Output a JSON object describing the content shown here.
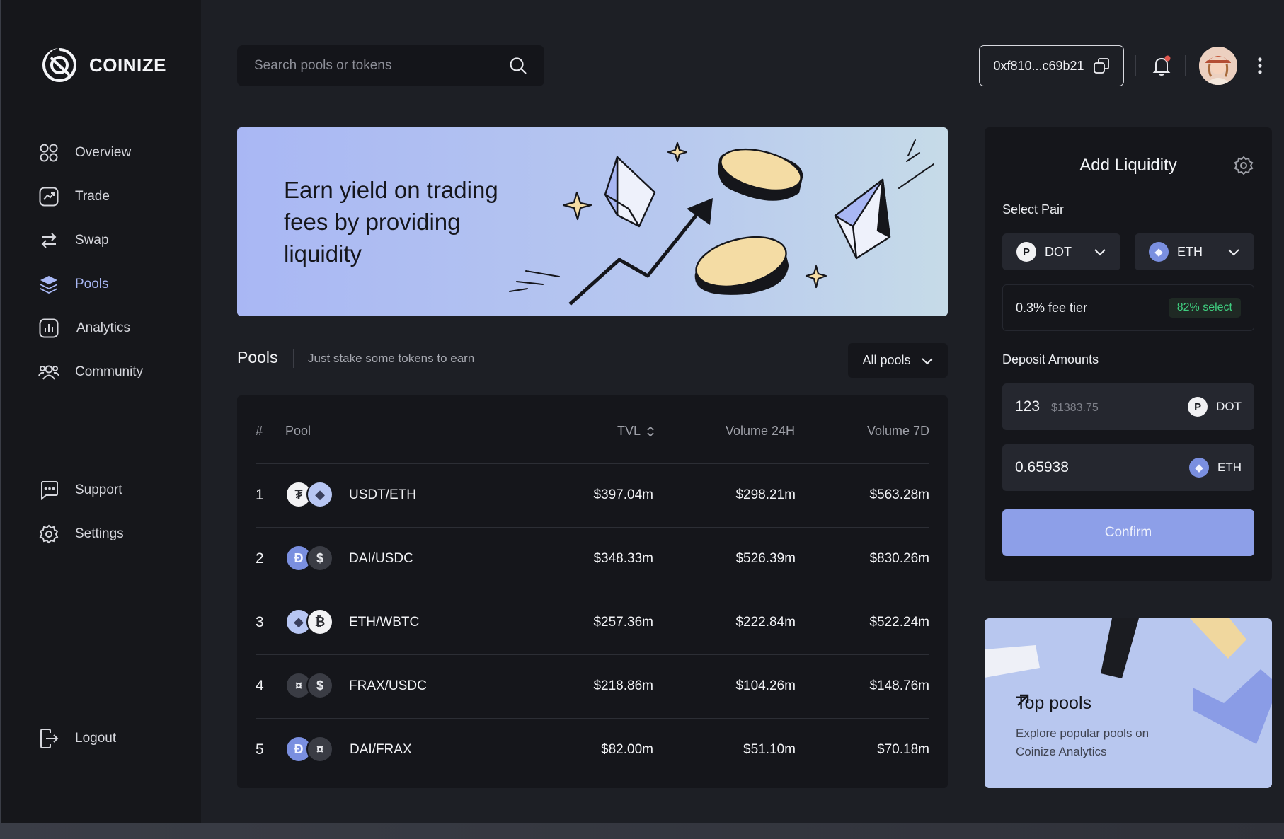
{
  "brand": {
    "name": "COINIZE"
  },
  "sidebar": {
    "items": [
      {
        "label": "Overview",
        "icon": "grid-icon"
      },
      {
        "label": "Trade",
        "icon": "trend-icon"
      },
      {
        "label": "Swap",
        "icon": "swap-icon"
      },
      {
        "label": "Pools",
        "icon": "layers-icon",
        "active": true
      },
      {
        "label": "Analytics",
        "icon": "bar-chart-icon"
      },
      {
        "label": "Community",
        "icon": "users-icon"
      }
    ],
    "secondary": [
      {
        "label": "Support",
        "icon": "chat-icon"
      },
      {
        "label": "Settings",
        "icon": "gear-icon"
      }
    ],
    "logout": "Logout"
  },
  "header": {
    "search_placeholder": "Search pools or tokens",
    "wallet": "0xf810...c69b21",
    "notification_dot_color": "#e2584f"
  },
  "hero": {
    "text": "Earn yield on trading fees by providing liquidity"
  },
  "pools": {
    "title": "Pools",
    "subtitle": "Just stake some tokens to earn",
    "filter": "All pools",
    "columns": {
      "index": "#",
      "pool": "Pool",
      "tvl": "TVL",
      "vol24": "Volume 24H",
      "vol7": "Volume 7D"
    },
    "rows": [
      {
        "n": "1",
        "pair": "USDT/ETH",
        "tvl": "$397.04m",
        "vol24": "$298.21m",
        "vol7": "$563.28m",
        "tokens": [
          "tether",
          "eth"
        ]
      },
      {
        "n": "2",
        "pair": "DAI/USDC",
        "tvl": "$348.33m",
        "vol24": "$526.39m",
        "vol7": "$830.26m",
        "tokens": [
          "dai",
          "usdc"
        ]
      },
      {
        "n": "3",
        "pair": "ETH/WBTC",
        "tvl": "$257.36m",
        "vol24": "$222.84m",
        "vol7": "$522.24m",
        "tokens": [
          "eth",
          "btc"
        ]
      },
      {
        "n": "4",
        "pair": "FRAX/USDC",
        "tvl": "$218.86m",
        "vol24": "$104.26m",
        "vol7": "$148.76m",
        "tokens": [
          "frax",
          "usdc"
        ]
      },
      {
        "n": "5",
        "pair": "DAI/FRAX",
        "tvl": "$82.00m",
        "vol24": "$51.10m",
        "vol7": "$70.18m",
        "tokens": [
          "dai",
          "frax"
        ]
      }
    ]
  },
  "liquidity": {
    "title": "Add Liquidity",
    "select_pair_label": "Select Pair",
    "token_a": "DOT",
    "token_b": "ETH",
    "fee_tier": "0.3% fee tier",
    "fee_badge": "82% select",
    "deposit_label": "Deposit Amounts",
    "deposit_a": {
      "value": "123",
      "usd": "$1383.75",
      "token": "DOT"
    },
    "deposit_b": {
      "value": "0.65938",
      "token": "ETH"
    },
    "confirm": "Confirm"
  },
  "top_pools": {
    "title": "Top pools",
    "description": "Explore popular pools on Coinize Analytics"
  },
  "colors": {
    "accent": "#a9b8f5",
    "button": "#8d9fe8",
    "badge_green": "#3fce7f"
  }
}
